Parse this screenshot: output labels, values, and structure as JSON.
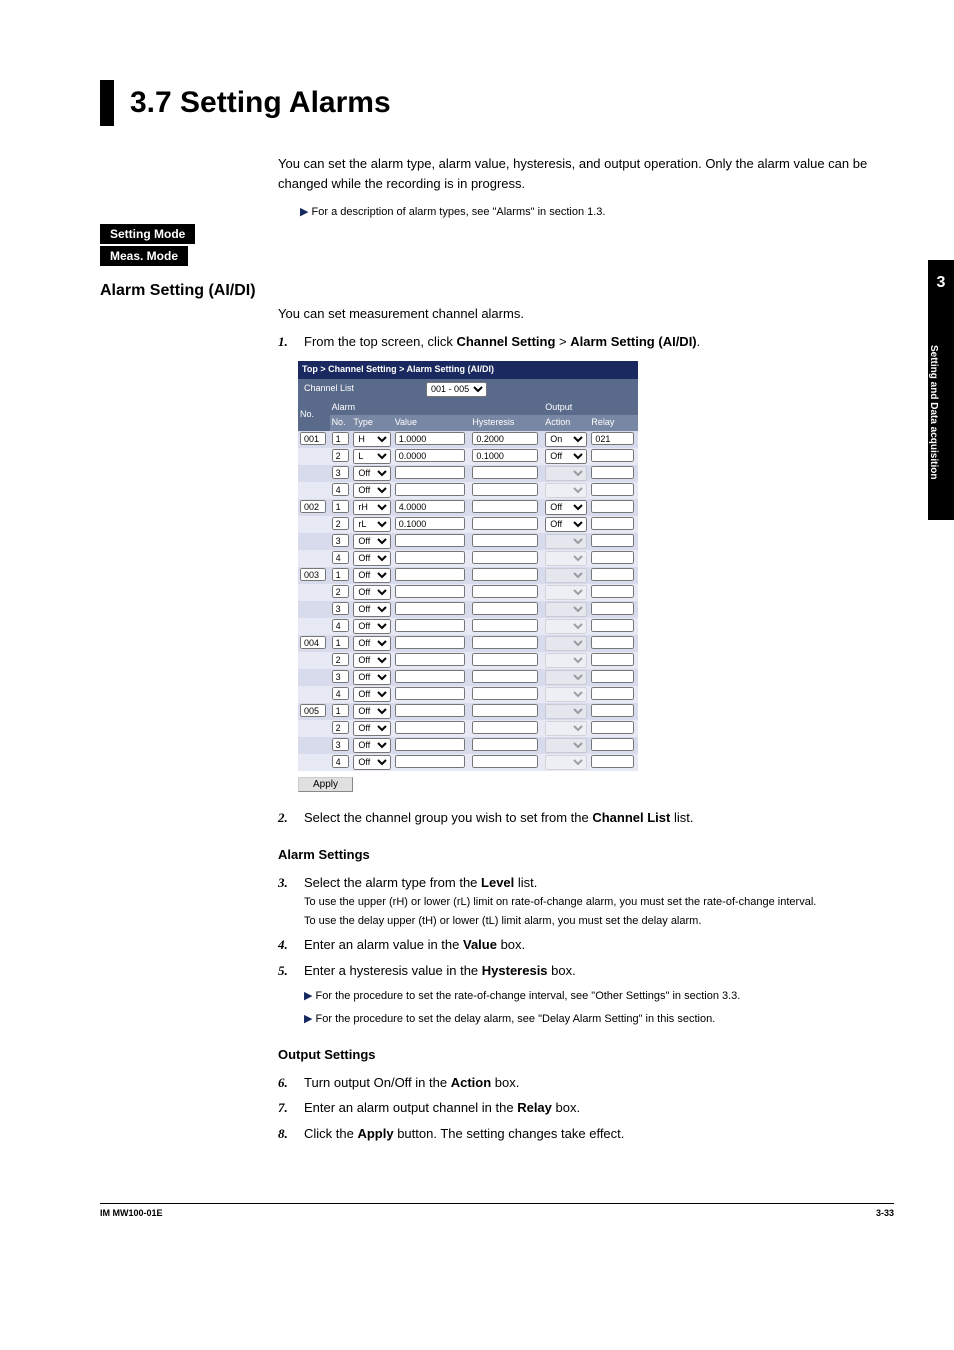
{
  "side_tab": {
    "chapter": "3",
    "label": "Setting and Data acquisition"
  },
  "title": "3.7   Setting Alarms",
  "intro": "You can set the alarm type, alarm value, hysteresis, and output operation. Only the alarm value can be changed while the recording is in progress.",
  "ref_top": "For a description of alarm types, see \"Alarms\" in section 1.3.",
  "mode_setting": "Setting Mode",
  "mode_meas": "Meas. Mode",
  "section_heading": "Alarm Setting (AI/DI)",
  "section_intro": "You can set measurement channel alarms.",
  "step1_pre": "From the top screen, click ",
  "step1_b1": "Channel Setting",
  "step1_mid": " > ",
  "step1_b2": "Alarm Setting (AI/DI)",
  "step1_post": ".",
  "shot": {
    "breadcrumb": "Top > Channel Setting > Alarm Setting (AI/DI)",
    "channel_list_label": "Channel List",
    "channel_list_value": "001 - 005",
    "col_no": "No.",
    "grp_alarm": "Alarm",
    "grp_output": "Output",
    "col_alarm_no": "No.",
    "col_type": "Type",
    "col_value": "Value",
    "col_hyst": "Hysteresis",
    "col_action": "Action",
    "col_relay": "Relay",
    "apply": "Apply",
    "rows": [
      {
        "ch": "001",
        "n": "1",
        "type": "H",
        "value": "1.0000",
        "hyst": "0.2000",
        "action": "On",
        "relay": "021"
      },
      {
        "ch": "",
        "n": "2",
        "type": "L",
        "value": "0.0000",
        "hyst": "0.1000",
        "action": "Off",
        "relay": ""
      },
      {
        "ch": "",
        "n": "3",
        "type": "Off",
        "value": "",
        "hyst": "",
        "action": "",
        "relay": ""
      },
      {
        "ch": "",
        "n": "4",
        "type": "Off",
        "value": "",
        "hyst": "",
        "action": "",
        "relay": ""
      },
      {
        "ch": "002",
        "n": "1",
        "type": "rH",
        "value": "4.0000",
        "hyst": "",
        "action": "Off",
        "relay": ""
      },
      {
        "ch": "",
        "n": "2",
        "type": "rL",
        "value": "0.1000",
        "hyst": "",
        "action": "Off",
        "relay": ""
      },
      {
        "ch": "",
        "n": "3",
        "type": "Off",
        "value": "",
        "hyst": "",
        "action": "",
        "relay": ""
      },
      {
        "ch": "",
        "n": "4",
        "type": "Off",
        "value": "",
        "hyst": "",
        "action": "",
        "relay": ""
      },
      {
        "ch": "003",
        "n": "1",
        "type": "Off",
        "value": "",
        "hyst": "",
        "action": "",
        "relay": ""
      },
      {
        "ch": "",
        "n": "2",
        "type": "Off",
        "value": "",
        "hyst": "",
        "action": "",
        "relay": ""
      },
      {
        "ch": "",
        "n": "3",
        "type": "Off",
        "value": "",
        "hyst": "",
        "action": "",
        "relay": ""
      },
      {
        "ch": "",
        "n": "4",
        "type": "Off",
        "value": "",
        "hyst": "",
        "action": "",
        "relay": ""
      },
      {
        "ch": "004",
        "n": "1",
        "type": "Off",
        "value": "",
        "hyst": "",
        "action": "",
        "relay": ""
      },
      {
        "ch": "",
        "n": "2",
        "type": "Off",
        "value": "",
        "hyst": "",
        "action": "",
        "relay": ""
      },
      {
        "ch": "",
        "n": "3",
        "type": "Off",
        "value": "",
        "hyst": "",
        "action": "",
        "relay": ""
      },
      {
        "ch": "",
        "n": "4",
        "type": "Off",
        "value": "",
        "hyst": "",
        "action": "",
        "relay": ""
      },
      {
        "ch": "005",
        "n": "1",
        "type": "Off",
        "value": "",
        "hyst": "",
        "action": "",
        "relay": ""
      },
      {
        "ch": "",
        "n": "2",
        "type": "Off",
        "value": "",
        "hyst": "",
        "action": "",
        "relay": ""
      },
      {
        "ch": "",
        "n": "3",
        "type": "Off",
        "value": "",
        "hyst": "",
        "action": "",
        "relay": ""
      },
      {
        "ch": "",
        "n": "4",
        "type": "Off",
        "value": "",
        "hyst": "",
        "action": "",
        "relay": ""
      }
    ]
  },
  "step2_pre": "Select the channel group you wish to set from the ",
  "step2_b": "Channel List",
  "step2_post": " list.",
  "alarm_settings_head": "Alarm Settings",
  "step3_pre": "Select the alarm type from the ",
  "step3_b": "Level",
  "step3_post": " list.",
  "step3_sub1": "To use the upper (rH) or lower (rL) limit on rate-of-change alarm, you must set the rate-of-change interval.",
  "step3_sub2": "To use the delay upper (tH) or lower (tL) limit alarm, you must set the delay alarm.",
  "step4_pre": "Enter an alarm value in the ",
  "step4_b": "Value",
  "step4_post": " box.",
  "step5_pre": "Enter a hysteresis value in the ",
  "step5_b": "Hysteresis",
  "step5_post": " box.",
  "ref_roc": "For the procedure to set the rate-of-change interval, see \"Other Settings\" in section 3.3.",
  "ref_delay": "For the procedure to set the delay alarm, see \"Delay Alarm Setting\" in this section.",
  "output_settings_head": "Output Settings",
  "step6_pre": "Turn output On/Off in the ",
  "step6_b": "Action",
  "step6_post": " box.",
  "step7_pre": "Enter an alarm output channel in the ",
  "step7_b": "Relay",
  "step7_post": " box.",
  "step8_pre": "Click the ",
  "step8_b": "Apply",
  "step8_post": " button. The setting changes take effect.",
  "footer_left": "IM MW100-01E",
  "footer_right": "3-33"
}
